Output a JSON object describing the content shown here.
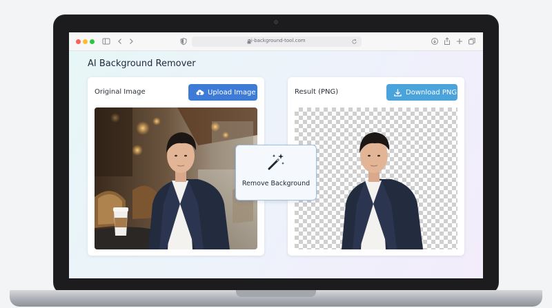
{
  "browser": {
    "url": "ai-background-tool.com"
  },
  "app": {
    "title": "AI Background Remover"
  },
  "original": {
    "title": "Original Image",
    "upload_label": "Upload Image",
    "image_alt": "Portrait photo of a man in a navy blazer at a cafe"
  },
  "result": {
    "title": "Result (PNG)",
    "download_label": "Download PNG",
    "image_alt": "Cutout of the man on transparent background"
  },
  "action": {
    "remove_label": "Remove Background"
  },
  "colors": {
    "upload_button": "#3d7bd6",
    "download_button": "#4aa3db",
    "action_border": "#9fc0e0"
  }
}
